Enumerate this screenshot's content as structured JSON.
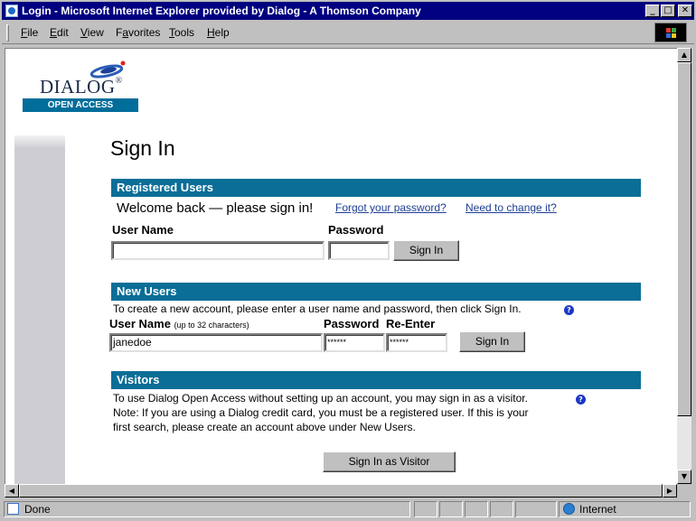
{
  "window": {
    "title": "Login - Microsoft Internet Explorer provided by Dialog - A Thomson Company",
    "minimize": "_",
    "maximize": "□",
    "close": "✕"
  },
  "menu": {
    "items": [
      {
        "key": "F",
        "rest": "ile"
      },
      {
        "key": "E",
        "rest": "dit"
      },
      {
        "key": "V",
        "rest": "iew"
      },
      {
        "key": "",
        "rest": "Favorites",
        "key_after": "a"
      },
      {
        "key": "T",
        "rest": "ools"
      },
      {
        "key": "H",
        "rest": "elp"
      }
    ]
  },
  "logo": {
    "brand": "DIALOG",
    "reg": "®",
    "product": "OPEN ACCESS"
  },
  "page": {
    "title": "Sign In"
  },
  "registered": {
    "header": "Registered Users",
    "welcome": "Welcome back — please sign in!",
    "forgot_link": "Forgot your password?",
    "change_link": "Need to change it?",
    "username_label": "User Name",
    "password_label": "Password",
    "username_value": "",
    "password_value": "",
    "button": "Sign In"
  },
  "new_users": {
    "header": "New Users",
    "instructions": "To create a new account, please enter a user name and password, then click Sign In.",
    "username_label": "User Name",
    "username_hint": "(up to 32 characters)",
    "password_label": "Password",
    "reenter_label": "Re-Enter",
    "username_value": "janedoe",
    "password_value": "******",
    "reenter_value": "******",
    "button": "Sign In"
  },
  "visitors": {
    "header": "Visitors",
    "line1": "To use Dialog Open Access without setting up an account, you may sign in as a visitor.",
    "line2": "Note: If you are using a Dialog credit card, you must be a registered user. If this is your",
    "line3": "first search, please create an account above under New Users.",
    "button": "Sign In as Visitor"
  },
  "status": {
    "text": "Done",
    "zone": "Internet"
  },
  "colors": {
    "section_bar": "#0b6e97",
    "logo_bar": "#006d9a",
    "title_bar": "#000080",
    "link": "#1d3f93"
  }
}
